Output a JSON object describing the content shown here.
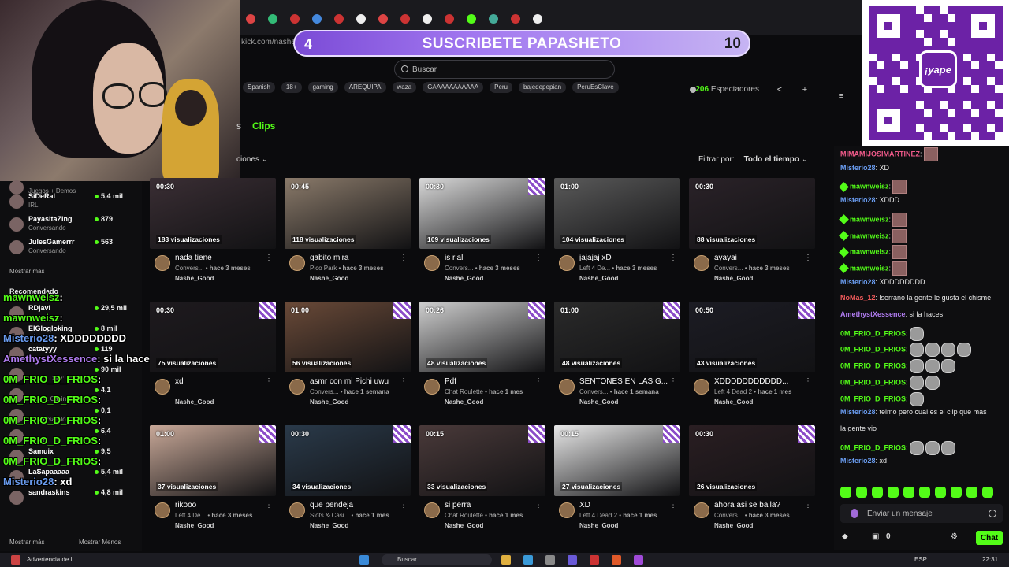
{
  "browser": {
    "url": "kick.com/nashe",
    "tab_colors": [
      "#d44",
      "#3b7",
      "#c33",
      "#48d",
      "#c33",
      "#eee",
      "#d44",
      "#c33",
      "#eee",
      "#c33",
      "#53fc18",
      "#4a9",
      "#c33",
      "#eee"
    ]
  },
  "banner": {
    "left_number": "4",
    "text": "SUSCRIBETE PAPASHETO",
    "right_number": "10"
  },
  "qr": {
    "logo_text": "¡yape"
  },
  "search": {
    "placeholder": "Buscar"
  },
  "stream": {
    "tags": [
      "Spanish",
      "18+",
      "gaming",
      "AREQUIPA",
      "waza",
      "GAAAAAAAAAAA",
      "Peru",
      "bajedepepian",
      "PeruEsClave"
    ],
    "viewers_count": "206",
    "viewers_label": "Espectadores"
  },
  "tabs": {
    "partial": "s",
    "clips": "Clips"
  },
  "sort": {
    "partial_label": "ciones"
  },
  "filter": {
    "label": "Filtrar por:",
    "value": "Todo el tiempo"
  },
  "sidebar": {
    "channels": [
      {
        "name": "",
        "category": "Juegos + Demos",
        "count": ""
      },
      {
        "name": "SiDeRaL",
        "category": "IRL",
        "count": "5,4 mil"
      },
      {
        "name": "PayasitaZing",
        "category": "Conversando",
        "count": "879"
      },
      {
        "name": "JulesGamerrr",
        "category": "Conversando",
        "count": "563"
      }
    ],
    "show_more": "Mostrar más",
    "recommended_label": "Recomendado",
    "recommended": [
      {
        "name": "RDjavi",
        "category": "",
        "count": "29,5 mil"
      },
      {
        "name": "ElGlogloking",
        "category": "",
        "count": "8 mil"
      },
      {
        "name": "catatyyy",
        "category": "",
        "count": "119"
      },
      {
        "name": "",
        "category": "Call Of Duty: Warzo...",
        "count": "90 mil"
      },
      {
        "name": "",
        "category": "Slots & Casino",
        "count": "4,1"
      },
      {
        "name": "",
        "category": "Conversando",
        "count": "0,1"
      },
      {
        "name": "",
        "category": "Hytale",
        "count": "6,4"
      },
      {
        "name": "Samuix",
        "category": "",
        "count": "9,5"
      },
      {
        "name": "LaSapaaaaa",
        "category": "",
        "count": "5,4 mil"
      },
      {
        "name": "sandraskins",
        "category": "",
        "count": "4,8 mil"
      }
    ],
    "footer_more": "Mostrar más",
    "footer_less": "Mostrar Menos"
  },
  "overlay_chat": [
    {
      "user": "mawnweisz",
      "text": ":",
      "color": "#53fc18"
    },
    {
      "user": "mawnweisz",
      "text": ":",
      "color": "#53fc18"
    },
    {
      "user": "Misterio28",
      "text": ": XDDDDDDDD",
      "color": "#6a9cf0"
    },
    {
      "user": "AmethystXessence",
      "text": ": si la haces",
      "color": "#b07cf0"
    },
    {
      "user": "0M_FRIO_D_FRIOS",
      "text": ":",
      "color": "#53fc18"
    },
    {
      "user": "0M_FRIO_D_FRIOS",
      "text": ":",
      "color": "#53fc18"
    },
    {
      "user": "0M_FRIO_D_FRIOS",
      "text": ":",
      "color": "#53fc18"
    },
    {
      "user": "0M_FRIO_D_FRIOS",
      "text": ":",
      "color": "#53fc18"
    },
    {
      "user": "0M_FRIO_D_FRIOS",
      "text": ":",
      "color": "#53fc18"
    },
    {
      "user": "Misterio28",
      "text": ": xd",
      "color": "#6a9cf0"
    }
  ],
  "clips": [
    {
      "duration": "00:30",
      "views": "183 visualizaciones",
      "title": "nada tiene",
      "category": "Convers...",
      "age": "hace 3 meses",
      "author": "Nashe_Good",
      "thumb": "#3a2e34"
    },
    {
      "duration": "00:45",
      "views": "118 visualizaciones",
      "title": "gabito mira",
      "category": "Pico Park",
      "age": "hace 3 meses",
      "author": "Nashe_Good",
      "thumb": "#8a7a6a"
    },
    {
      "duration": "00:30",
      "views": "109 visualizaciones",
      "title": "is rial",
      "category": "Convers...",
      "age": "hace 3 meses",
      "author": "Nashe_Good",
      "thumb": "#d8d8d8"
    },
    {
      "duration": "01:00",
      "views": "104 visualizaciones",
      "title": "jajajaj xD",
      "category": "Left 4 De...",
      "age": "hace 3 meses",
      "author": "Nashe_Good",
      "thumb": "#5a5a5a"
    },
    {
      "duration": "00:30",
      "views": "88 visualizaciones",
      "title": "ayayai",
      "category": "Convers...",
      "age": "hace 3 meses",
      "author": "Nashe_Good",
      "thumb": "#2a2228"
    },
    {
      "duration": "00:30",
      "views": "75 visualizaciones",
      "title": "xd",
      "category": "",
      "age": "",
      "author": "Nashe_Good",
      "thumb": "#1e1a1e"
    },
    {
      "duration": "01:00",
      "views": "56 visualizaciones",
      "title": "asmr con mi Pichi uwu",
      "category": "Convers...",
      "age": "hace 1 semana",
      "author": "Nashe_Good",
      "thumb": "#6a4a38"
    },
    {
      "duration": "00:26",
      "views": "48 visualizaciones",
      "title": "Pdf",
      "category": "Chat Roulette",
      "age": "hace 1 mes",
      "author": "Nashe_Good",
      "thumb": "#cfcfcf"
    },
    {
      "duration": "01:00",
      "views": "48 visualizaciones",
      "title": "SENTONES EN LAS G...",
      "category": "Convers...",
      "age": "hace 1 semana",
      "author": "Nashe_Good",
      "thumb": "#2a2a2a"
    },
    {
      "duration": "00:50",
      "views": "43 visualizaciones",
      "title": "XDDDDDDDDDDD...",
      "category": "Left 4 Dead 2",
      "age": "hace 1 mes",
      "author": "Nashe_Good",
      "thumb": "#1c1c24"
    },
    {
      "duration": "01:00",
      "views": "37 visualizaciones",
      "title": "rikooo",
      "category": "Left 4 De...",
      "age": "hace 3 meses",
      "author": "Nashe_Good",
      "thumb": "#c8a898"
    },
    {
      "duration": "00:30",
      "views": "34 visualizaciones",
      "title": "que pendeja",
      "category": "Slots & Casi...",
      "age": "hace 1 mes",
      "author": "Nashe_Good",
      "thumb": "#2a3a4a"
    },
    {
      "duration": "00:15",
      "views": "33 visualizaciones",
      "title": "si perra",
      "category": "Chat Roulette",
      "age": "hace 1 mes",
      "author": "Nashe_Good",
      "thumb": "#4a3a3a"
    },
    {
      "duration": "00:15",
      "views": "27 visualizaciones",
      "title": "XD",
      "category": "Left 4 Dead 2",
      "age": "hace 1 mes",
      "author": "Nashe_Good",
      "thumb": "#e8e8e8"
    },
    {
      "duration": "00:30",
      "views": "26 visualizaciones",
      "title": "ahora asi se baila?",
      "category": "Convers...",
      "age": "hace 3 meses",
      "author": "Nashe_Good",
      "thumb": "#2a1e22"
    }
  ],
  "chat": {
    "messages": [
      {
        "user": "MIMAMIJOSIMARTINEZ",
        "text": ":",
        "color": "#f05a8a",
        "badge": false,
        "emotes": 1
      },
      {
        "user": "Misterio28",
        "text": ": XD",
        "color": "#6a9cf0",
        "badge": false,
        "emotes": 0
      },
      {
        "user": "mawnweisz",
        "text": ":",
        "color": "#53fc18",
        "badge": true,
        "emotes": 1
      },
      {
        "user": "Misterio28",
        "text": ": XDDD",
        "color": "#6a9cf0",
        "badge": false,
        "emotes": 0
      },
      {
        "user": "mawnweisz",
        "text": ":",
        "color": "#53fc18",
        "badge": true,
        "emotes": 1
      },
      {
        "user": "mawnweisz",
        "text": ":",
        "color": "#53fc18",
        "badge": true,
        "emotes": 1
      },
      {
        "user": "mawnweisz",
        "text": ":",
        "color": "#53fc18",
        "badge": true,
        "emotes": 1
      },
      {
        "user": "mawnweisz",
        "text": ":",
        "color": "#53fc18",
        "badge": true,
        "emotes": 1
      },
      {
        "user": "Misterio28",
        "text": ": XDDDDDDDD",
        "color": "#6a9cf0",
        "badge": false,
        "emotes": 0
      },
      {
        "user": "NoMas_12",
        "text": ": lserrano la gente le gusta el chisme",
        "color": "#f05a5a",
        "badge": false,
        "emotes": 0
      },
      {
        "user": "AmethystXessence",
        "text": ": si la haces",
        "color": "#b07cf0",
        "badge": false,
        "emotes": 0
      },
      {
        "user": "0M_FRIO_D_FRIOS",
        "text": ":",
        "color": "#53fc18",
        "badge": false,
        "emotes": 1
      },
      {
        "user": "0M_FRIO_D_FRIOS",
        "text": ":",
        "color": "#53fc18",
        "badge": false,
        "emotes": 4
      },
      {
        "user": "0M_FRIO_D_FRIOS",
        "text": ":",
        "color": "#53fc18",
        "badge": false,
        "emotes": 3
      },
      {
        "user": "0M_FRIO_D_FRIOS",
        "text": ":",
        "color": "#53fc18",
        "badge": false,
        "emotes": 2
      },
      {
        "user": "0M_FRIO_D_FRIOS",
        "text": ":",
        "color": "#53fc18",
        "badge": false,
        "emotes": 1
      },
      {
        "user": "Misterio28",
        "text": ": telmo pero cual es el clip que mas",
        "color": "#6a9cf0",
        "badge": false,
        "emotes": 0
      },
      {
        "user": "",
        "text": "la gente vio",
        "color": "#e8e8e8",
        "badge": false,
        "emotes": 0
      },
      {
        "user": "0M_FRIO_D_FRIOS",
        "text": ":",
        "color": "#53fc18",
        "badge": false,
        "emotes": 3
      },
      {
        "user": "Misterio28",
        "text": ": xd",
        "color": "#6a9cf0",
        "badge": false,
        "emotes": 0
      }
    ],
    "input_placeholder": "Enviar un mensaje",
    "points": "0",
    "send_label": "Chat"
  },
  "taskbar": {
    "notification": "Advertencia de l...",
    "search": "Buscar",
    "lang": "ESP",
    "time": "22:31"
  }
}
